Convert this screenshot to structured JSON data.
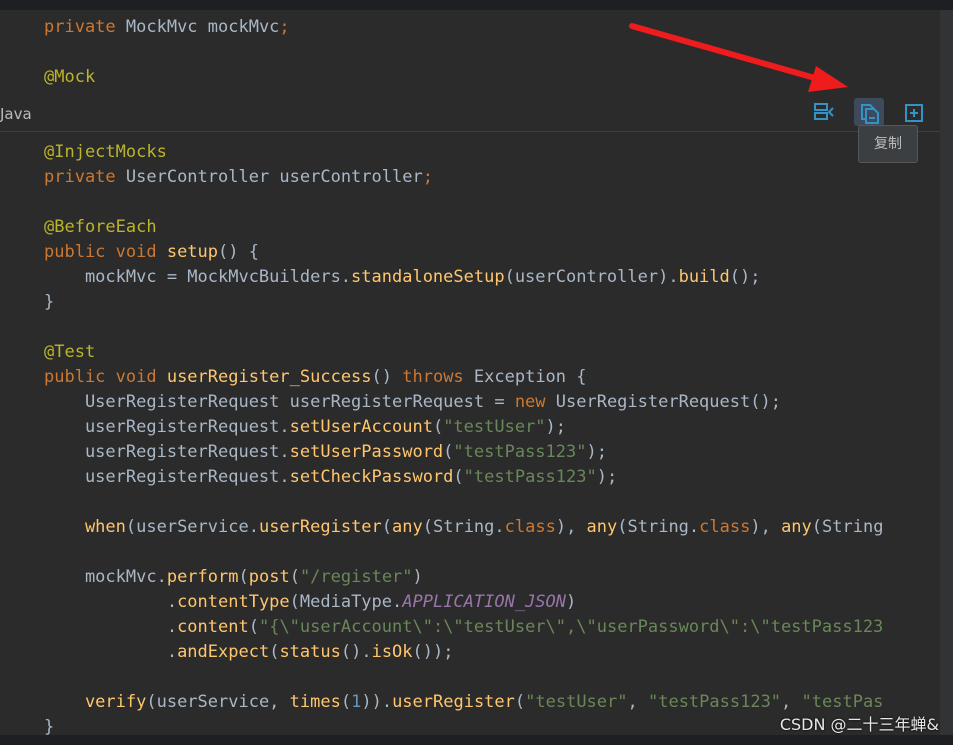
{
  "ide": {
    "language_label": "Java",
    "copy_tooltip": "复制"
  },
  "watermark": "CSDN @二十三年蝉&",
  "code": {
    "l_mockmvc_field": {
      "kw": "private ",
      "type": "MockMvc mockMvc",
      "semi": ";"
    },
    "l_mock_ann": "@Mock",
    "l_injectmocks_ann": "@InjectMocks",
    "l_controller_field": {
      "kw": "private ",
      "rest": "UserController userController",
      "semi": ";"
    },
    "l_beforeeach_ann": "@BeforeEach",
    "l_setup_sig": {
      "kw": "public void ",
      "name": "setup",
      "rest": "() {"
    },
    "l_setup_body": {
      "a": "    mockMvc = MockMvcBuilders.",
      "fn1": "standaloneSetup",
      "b": "(userController).",
      "fn2": "build",
      "c": "();"
    },
    "l_close1": "}",
    "l_test_ann": "@Test",
    "l_test_sig": {
      "kw": "public void ",
      "name": "userRegister_Success",
      "p": "() ",
      "kw2": "throws",
      "rest": " Exception {"
    },
    "l_new_req": {
      "a": "    UserRegisterRequest userRegisterRequest = ",
      "kw": "new",
      "b": " UserRegisterRequest();"
    },
    "l_set_account": {
      "a": "    userRegisterRequest.",
      "fn": "setUserAccount",
      "b": "(",
      "s": "\"testUser\"",
      "c": ");"
    },
    "l_set_password": {
      "a": "    userRegisterRequest.",
      "fn": "setUserPassword",
      "b": "(",
      "s": "\"testPass123\"",
      "c": ");"
    },
    "l_set_check": {
      "a": "    userRegisterRequest.",
      "fn": "setCheckPassword",
      "b": "(",
      "s": "\"testPass123\"",
      "c": ");"
    },
    "l_when": {
      "fn1": "    when",
      "a": "(userService.",
      "fn2": "userRegister",
      "b": "(",
      "fn3": "any",
      "c": "(String.",
      "cls": "class",
      "d": "), ",
      "fn4": "any",
      "e": "(String.",
      "cls2": "class",
      "f": "), ",
      "fn5": "any",
      "g": "(String"
    },
    "l_perform": {
      "a": "    mockMvc.",
      "fn1": "perform",
      "b": "(",
      "fn2": "post",
      "c": "(",
      "s": "\"/register\"",
      "d": ")"
    },
    "l_contenttype": {
      "a": "            .",
      "fn": "contentType",
      "b": "(MediaType.",
      "c": "APPLICATION_JSON",
      "d": ")"
    },
    "l_content": {
      "a": "            .",
      "fn": "content",
      "b": "(",
      "s": "\"{\\\"userAccount\\\":\\\"testUser\\\",\\\"userPassword\\\":\\\"testPass123"
    },
    "l_andexpect": {
      "a": "            .",
      "fn1": "andExpect",
      "b": "(",
      "fn2": "status",
      "c": "().",
      "fn3": "isOk",
      "d": "());"
    },
    "l_verify": {
      "fn1": "    verify",
      "a": "(userService, ",
      "fn2": "times",
      "b": "(",
      "n": "1",
      "c": ")).",
      "fn3": "userRegister",
      "d": "(",
      "s1": "\"testUser\"",
      "e": ", ",
      "s2": "\"testPass123\"",
      "f": ", ",
      "s3": "\"testPas"
    },
    "l_close2": "}"
  }
}
